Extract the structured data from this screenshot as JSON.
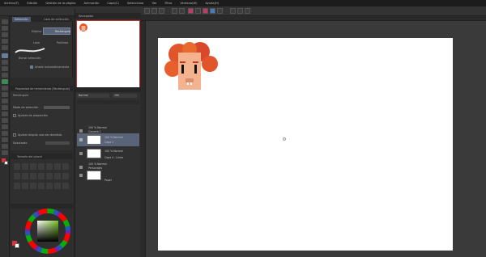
{
  "menu": [
    "Archivo(F)",
    "Edición",
    "Gestión de la página",
    "Animación",
    "Capa(C)",
    "Seleccionar",
    "Ver",
    "Filtro",
    "Ventana(W)",
    "Ayuda(H)"
  ],
  "subtool": {
    "tabs": [
      "Selección",
      "Lazo de selección"
    ],
    "items": [
      {
        "label": "Elíptico",
        "preview": "Rectángulo"
      },
      {
        "label": "Lazo",
        "preview": "Polilínea"
      }
    ],
    "brush_label": "Borrar selección",
    "add_label": "Añadir automáticamente"
  },
  "toolprop": {
    "title": "Propiedad de herramienta [Rectángulo]",
    "name": "Rectángulo",
    "rows": [
      "Modo de selección",
      "Ajustes de proporción",
      "Ajustar ángulo una vez decidido",
      "Suavizado"
    ]
  },
  "brushsize": {
    "title": "Tamaño del pincel"
  },
  "navigator": {
    "title": "Navegador"
  },
  "layers": {
    "blend": "Normal",
    "opacity": "100",
    "items": [
      {
        "name": "100 % Normal",
        "sub": "Carpeta 1"
      },
      {
        "name": "100 % Normal",
        "sub": "Capa 1"
      },
      {
        "name": "100 % Normal",
        "sub": "Capa 4 - Línea"
      },
      {
        "name": "100 % Normal",
        "sub": "Personajes"
      },
      {
        "name": "Papel",
        "sub": ""
      }
    ]
  },
  "colors": {
    "bg": "#2b2b2b",
    "panel": "#303030",
    "paper": "#ffffff",
    "hair": "#e0552a",
    "skin": "#f4b28e",
    "selected_layer": "#5a6478"
  }
}
